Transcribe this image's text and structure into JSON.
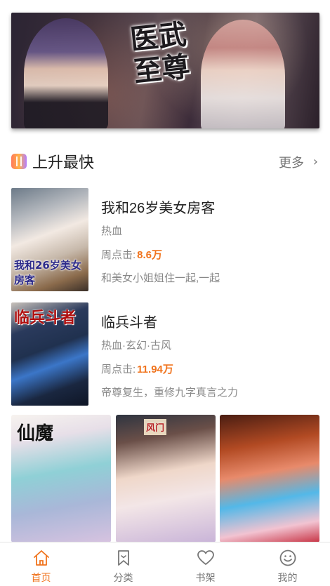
{
  "banner": {
    "title_art": "医武至尊"
  },
  "section": {
    "title": "上升最快",
    "more_label": "更多",
    "more_icon": "chevron-right-icon",
    "badge_icon": "trending-badge-icon"
  },
  "list": [
    {
      "name": "我和26岁美女房客",
      "genre": "热血",
      "clicks_label": "周点击:",
      "clicks_value": "8.6万",
      "desc": "和美女小姐姐住一起,一起",
      "cover_text": "我和26岁美女房客"
    },
    {
      "name": "临兵斗者",
      "genre": "热血·玄幻·古风",
      "clicks_label": "周点击:",
      "clicks_value": "11.94万",
      "desc": "帝尊复生，重修九字真言之力",
      "cover_text": "临兵斗者"
    }
  ],
  "grid": [
    {
      "title_art": "仙魔"
    },
    {
      "title_art": "风门"
    },
    {
      "title_art": ""
    }
  ],
  "tabs": [
    {
      "label": "首页",
      "icon": "home-icon",
      "active": true
    },
    {
      "label": "分类",
      "icon": "bookmark-icon",
      "active": false
    },
    {
      "label": "书架",
      "icon": "heart-icon",
      "active": false
    },
    {
      "label": "我的",
      "icon": "smile-icon",
      "active": false
    }
  ],
  "colors": {
    "accent": "#f0741e",
    "text_primary": "#222222",
    "text_secondary": "#888888"
  }
}
